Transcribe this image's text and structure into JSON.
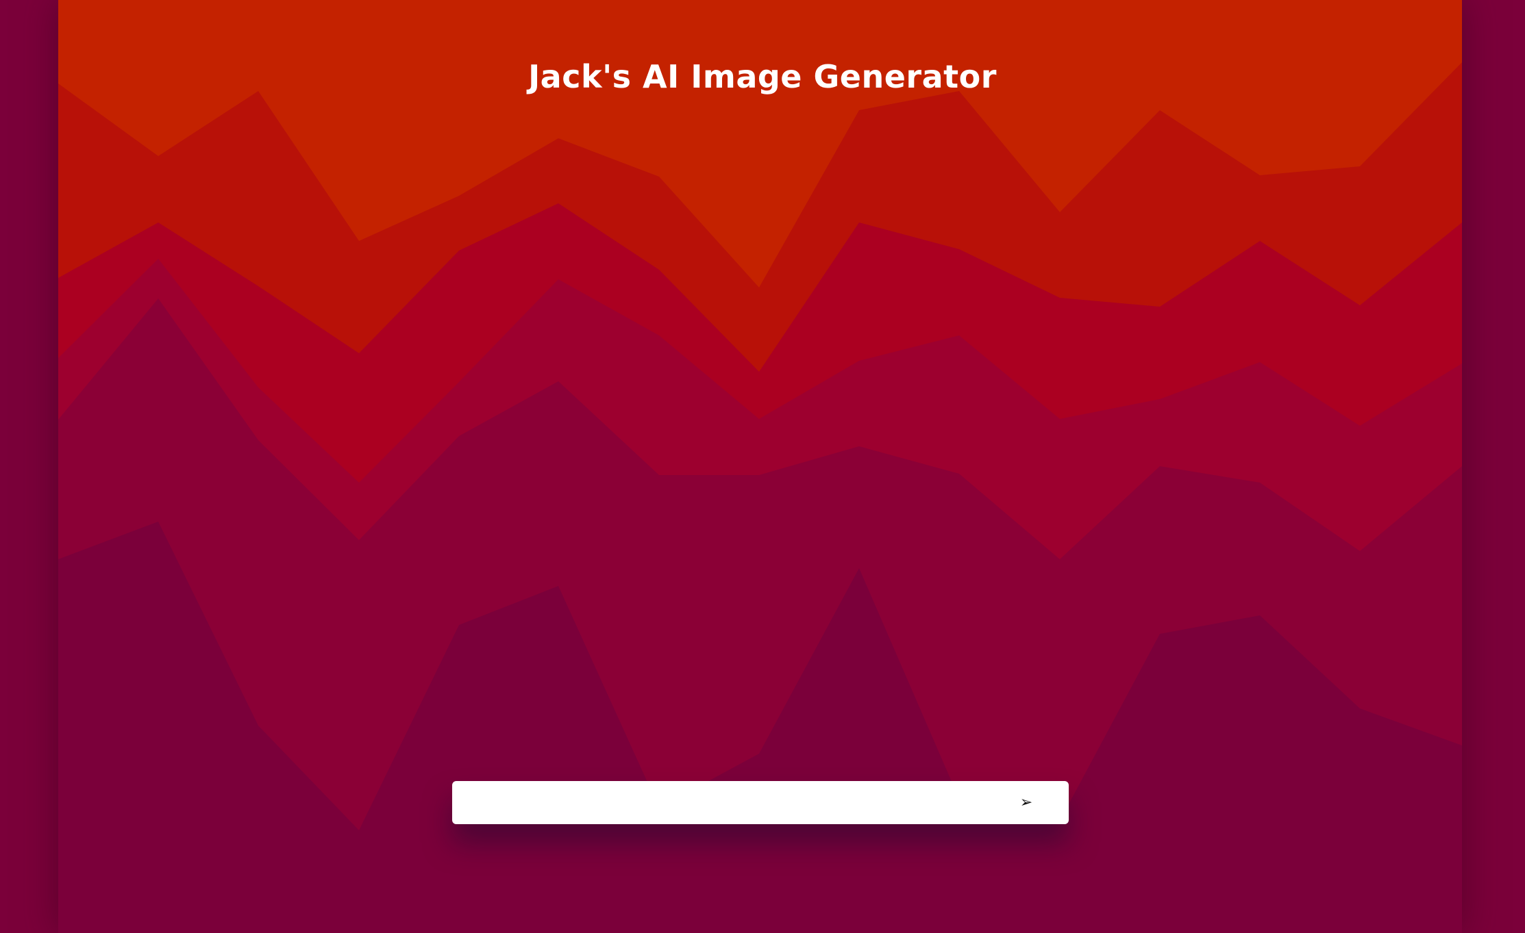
{
  "header": {
    "title": "Jack's AI Image Generator"
  },
  "prompt": {
    "value": "",
    "placeholder": ""
  },
  "send_button": {
    "icon": "send-arrow-icon",
    "glyph": "➢"
  },
  "colors": {
    "page_background": "#7b003a",
    "band_1": "#c42200",
    "band_2": "#b81108",
    "band_3": "#ab0021",
    "band_4": "#9d002f",
    "band_5": "#8b0036",
    "band_6": "#7b003a",
    "input_background": "#ffffff",
    "title_text": "#ffffff"
  }
}
